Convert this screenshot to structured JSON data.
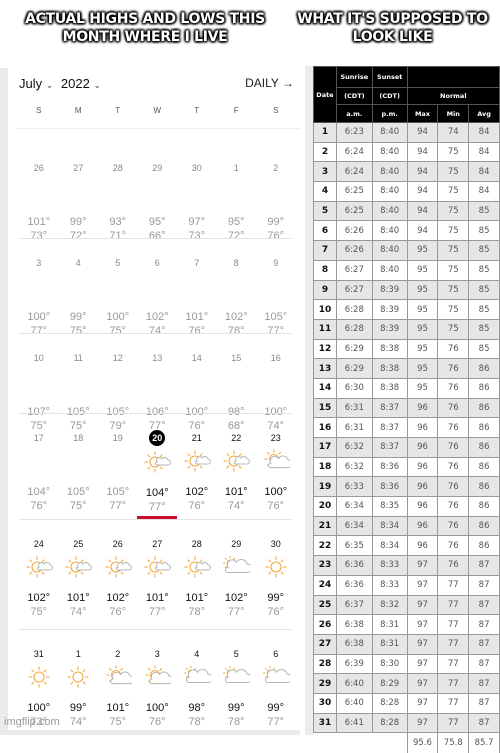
{
  "captions": {
    "left": "ACTUAL HIGHS AND LOWS THIS MONTH WHERE I LIVE",
    "right": "WHAT IT'S SUPPOSED TO LOOK LIKE"
  },
  "calendar": {
    "month": "July",
    "year": "2022",
    "view_button": "DAILY →",
    "weekdays": [
      "S",
      "M",
      "T",
      "W",
      "T",
      "F",
      "S"
    ],
    "weeks": [
      [
        {
          "day": "26",
          "hi": "101°",
          "lo": "73°"
        },
        {
          "day": "27",
          "hi": "99°",
          "lo": "72°"
        },
        {
          "day": "28",
          "hi": "93°",
          "lo": "71°"
        },
        {
          "day": "29",
          "hi": "95°",
          "lo": "66°"
        },
        {
          "day": "30",
          "hi": "97°",
          "lo": "73°"
        },
        {
          "day": "1",
          "hi": "95°",
          "lo": "72°"
        },
        {
          "day": "2",
          "hi": "99°",
          "lo": "76°"
        }
      ],
      [
        {
          "day": "3",
          "hi": "100°",
          "lo": "77°"
        },
        {
          "day": "4",
          "hi": "99°",
          "lo": "75°"
        },
        {
          "day": "5",
          "hi": "100°",
          "lo": "75°"
        },
        {
          "day": "6",
          "hi": "102°",
          "lo": "74°"
        },
        {
          "day": "7",
          "hi": "101°",
          "lo": "76°"
        },
        {
          "day": "8",
          "hi": "102°",
          "lo": "78°"
        },
        {
          "day": "9",
          "hi": "105°",
          "lo": "77°"
        }
      ],
      [
        {
          "day": "10",
          "hi": "107°",
          "lo": "75°"
        },
        {
          "day": "11",
          "hi": "105°",
          "lo": "75°"
        },
        {
          "day": "12",
          "hi": "105°",
          "lo": "79°"
        },
        {
          "day": "13",
          "hi": "106°",
          "lo": "77°"
        },
        {
          "day": "14",
          "hi": "100°",
          "lo": "76°"
        },
        {
          "day": "15",
          "hi": "98°",
          "lo": "68°"
        },
        {
          "day": "16",
          "hi": "100°",
          "lo": "74°"
        }
      ],
      [
        {
          "day": "17",
          "hi": "104°",
          "lo": "76°"
        },
        {
          "day": "18",
          "hi": "105°",
          "lo": "75°"
        },
        {
          "day": "19",
          "hi": "105°",
          "lo": "77°"
        },
        {
          "day": "20",
          "hi": "104°",
          "lo": "77°",
          "today": true,
          "icon": "sun-partly-cloudy-icon"
        },
        {
          "day": "21",
          "hi": "102°",
          "lo": "76°",
          "future": true,
          "icon": "sun-partly-cloudy-icon"
        },
        {
          "day": "22",
          "hi": "101°",
          "lo": "74°",
          "future": true,
          "icon": "sun-partly-cloudy-icon"
        },
        {
          "day": "23",
          "hi": "100°",
          "lo": "76°",
          "future": true,
          "icon": "mostly-sunny-icon"
        }
      ],
      [
        {
          "day": "24",
          "hi": "102°",
          "lo": "75°",
          "future": true,
          "icon": "sun-partly-cloudy-icon"
        },
        {
          "day": "25",
          "hi": "101°",
          "lo": "74°",
          "future": true,
          "icon": "sun-partly-cloudy-icon"
        },
        {
          "day": "26",
          "hi": "102°",
          "lo": "76°",
          "future": true,
          "icon": "sun-partly-cloudy-icon"
        },
        {
          "day": "27",
          "hi": "101°",
          "lo": "77°",
          "future": true,
          "icon": "sun-partly-cloudy-icon"
        },
        {
          "day": "28",
          "hi": "101°",
          "lo": "78°",
          "future": true,
          "icon": "sun-partly-cloudy-icon"
        },
        {
          "day": "29",
          "hi": "102°",
          "lo": "77°",
          "future": true,
          "icon": "mostly-cloudy-icon"
        },
        {
          "day": "30",
          "hi": "99°",
          "lo": "76°",
          "future": true,
          "icon": "sunny-icon"
        }
      ],
      [
        {
          "day": "31",
          "hi": "100°",
          "lo": "73°",
          "future": true,
          "icon": "sunny-icon"
        },
        {
          "day": "1",
          "hi": "99°",
          "lo": "74°",
          "future": true,
          "icon": "sunny-icon"
        },
        {
          "day": "2",
          "hi": "101°",
          "lo": "75°",
          "future": true,
          "icon": "mostly-sunny-icon"
        },
        {
          "day": "3",
          "hi": "100°",
          "lo": "76°",
          "future": true,
          "icon": "mostly-sunny-icon"
        },
        {
          "day": "4",
          "hi": "98°",
          "lo": "78°",
          "future": true,
          "icon": "mostly-cloudy-icon"
        },
        {
          "day": "5",
          "hi": "99°",
          "lo": "78°",
          "future": true,
          "icon": "mostly-cloudy-icon"
        },
        {
          "day": "6",
          "hi": "99°",
          "lo": "77°",
          "future": true,
          "icon": "mostly-cloudy-icon"
        }
      ]
    ]
  },
  "normals_table": {
    "headers": {
      "date": "Date",
      "sunrise": [
        "Sunrise",
        "(CDT)",
        "a.m."
      ],
      "sunset": [
        "Sunset",
        "(CDT)",
        "p.m."
      ],
      "normal": "Normal",
      "max": "Max",
      "min": "Min",
      "avg": "Avg"
    },
    "rows": [
      [
        "1",
        "6:23",
        "8:40",
        "94",
        "74",
        "84"
      ],
      [
        "2",
        "6:24",
        "8:40",
        "94",
        "75",
        "84"
      ],
      [
        "3",
        "6:24",
        "8:40",
        "94",
        "75",
        "84"
      ],
      [
        "4",
        "6:25",
        "8:40",
        "94",
        "75",
        "84"
      ],
      [
        "5",
        "6:25",
        "8:40",
        "94",
        "75",
        "85"
      ],
      [
        "6",
        "6:26",
        "8:40",
        "94",
        "75",
        "85"
      ],
      [
        "7",
        "6:26",
        "8:40",
        "95",
        "75",
        "85"
      ],
      [
        "8",
        "6:27",
        "8:40",
        "95",
        "75",
        "85"
      ],
      [
        "9",
        "6:27",
        "8:39",
        "95",
        "75",
        "85"
      ],
      [
        "10",
        "6:28",
        "8:39",
        "95",
        "75",
        "85"
      ],
      [
        "11",
        "6:28",
        "8:39",
        "95",
        "75",
        "85"
      ],
      [
        "12",
        "6:29",
        "8:38",
        "95",
        "76",
        "85"
      ],
      [
        "13",
        "6:29",
        "8:38",
        "95",
        "76",
        "86"
      ],
      [
        "14",
        "6:30",
        "8:38",
        "95",
        "76",
        "86"
      ],
      [
        "15",
        "6:31",
        "8:37",
        "96",
        "76",
        "86"
      ],
      [
        "16",
        "6:31",
        "8:37",
        "96",
        "76",
        "86"
      ],
      [
        "17",
        "6:32",
        "8:37",
        "96",
        "76",
        "86"
      ],
      [
        "18",
        "6:32",
        "8:36",
        "96",
        "76",
        "86"
      ],
      [
        "19",
        "6:33",
        "8:36",
        "96",
        "76",
        "86"
      ],
      [
        "20",
        "6:34",
        "8:35",
        "96",
        "76",
        "86"
      ],
      [
        "21",
        "6:34",
        "8:34",
        "96",
        "76",
        "86"
      ],
      [
        "22",
        "6:35",
        "8:34",
        "96",
        "76",
        "86"
      ],
      [
        "23",
        "6:36",
        "8:33",
        "97",
        "76",
        "87"
      ],
      [
        "24",
        "6:36",
        "8:33",
        "97",
        "77",
        "87"
      ],
      [
        "25",
        "6:37",
        "8:32",
        "97",
        "77",
        "87"
      ],
      [
        "26",
        "6:38",
        "8:31",
        "97",
        "77",
        "87"
      ],
      [
        "27",
        "6:38",
        "8:31",
        "97",
        "77",
        "87"
      ],
      [
        "28",
        "6:39",
        "8:30",
        "97",
        "77",
        "87"
      ],
      [
        "29",
        "6:40",
        "8:29",
        "97",
        "77",
        "87"
      ],
      [
        "30",
        "6:40",
        "8:28",
        "97",
        "77",
        "87"
      ],
      [
        "31",
        "6:41",
        "8:28",
        "97",
        "77",
        "87"
      ]
    ],
    "averages": [
      "95.6",
      "75.8",
      "85.7"
    ]
  },
  "watermark": "imgflip.com",
  "colors": {
    "today_marker": "#c8102e",
    "sun": "#f2a93b",
    "cloud": "#b5b5b5",
    "header_bg": "#000000"
  }
}
